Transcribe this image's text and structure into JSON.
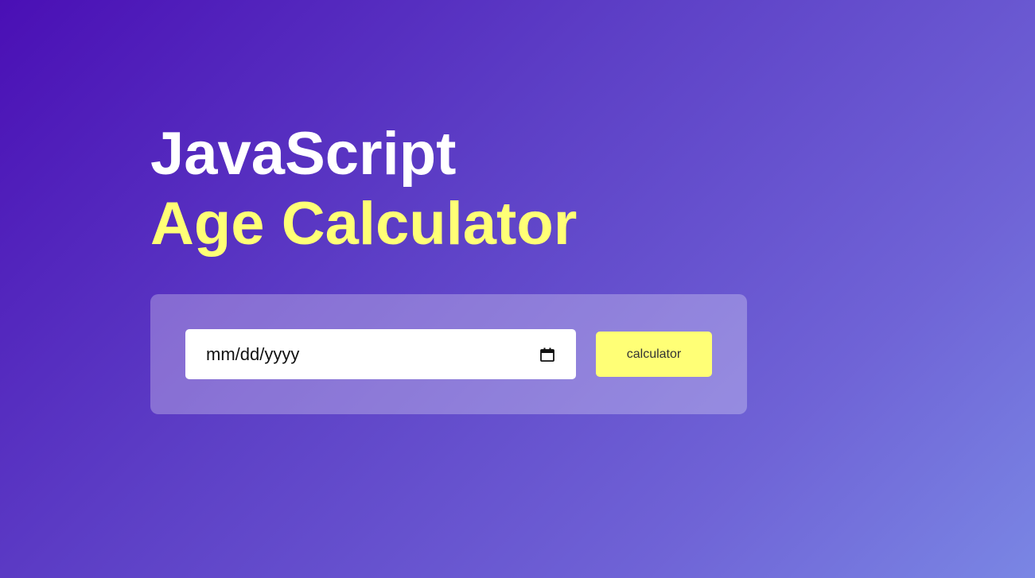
{
  "heading": {
    "line1": "JavaScript",
    "line2": "Age Calculator"
  },
  "form": {
    "date_placeholder": "mm/dd/yyyy",
    "calendar_icon": "calendar-icon",
    "button_label": "calculator"
  },
  "colors": {
    "accent": "#ffff76",
    "gradient_start": "#4a0fb5",
    "gradient_end": "#7a86e4",
    "heading_primary": "#ffffff"
  }
}
